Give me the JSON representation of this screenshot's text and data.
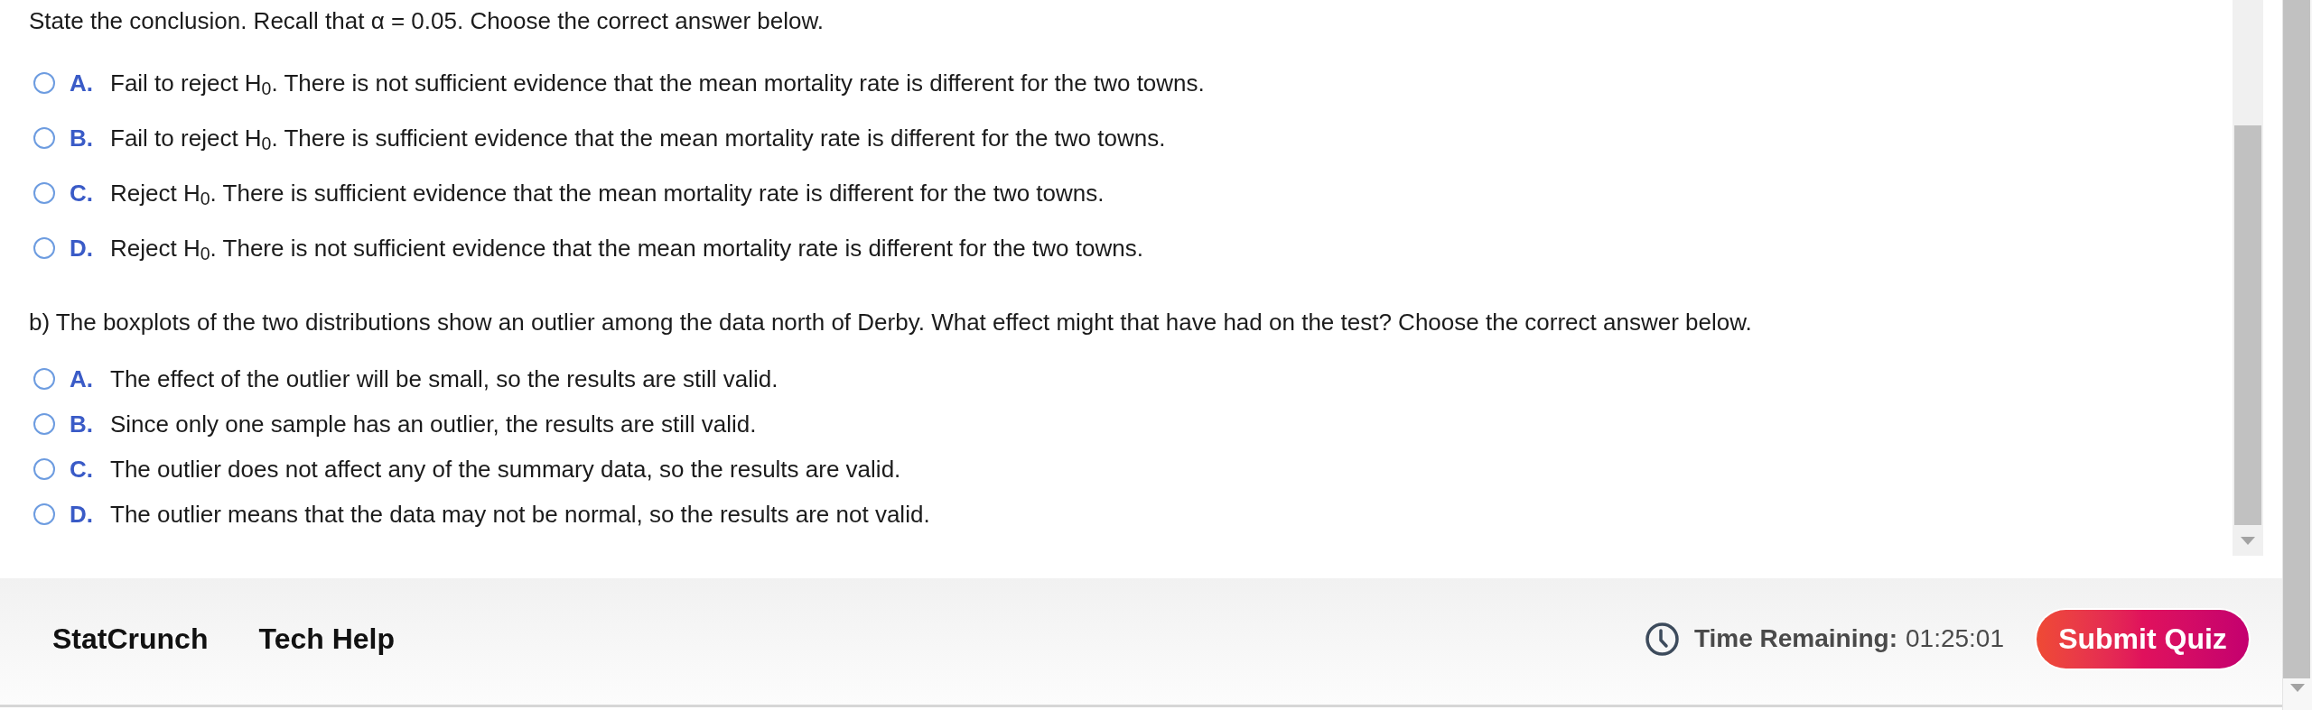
{
  "part_a": {
    "prompt": "State the conclusion. Recall that α = 0.05. Choose the correct answer below.",
    "options": [
      {
        "letter": "A.",
        "text": "Fail to reject H$_{0}$. There is not sufficient evidence that the mean mortality rate is different for the two towns.",
        "selected": false
      },
      {
        "letter": "B.",
        "text": "Fail to reject H$_{0}$. There is sufficient evidence that the mean mortality rate is different for the two towns.",
        "selected": false
      },
      {
        "letter": "C.",
        "text": "Reject H$_{0}$. There is sufficient evidence that the mean mortality rate is different for the two towns.",
        "selected": false
      },
      {
        "letter": "D.",
        "text": "Reject H$_{0}$. There is not sufficient evidence that the mean mortality rate is different for the two towns.",
        "selected": false
      }
    ]
  },
  "part_b": {
    "prompt": "b) The boxplots of the two distributions show an outlier among the data north of Derby. What effect might that have had on the test? Choose the correct answer below.",
    "options": [
      {
        "letter": "A.",
        "text": "The effect of the outlier will be small, so the results are still valid.",
        "selected": false
      },
      {
        "letter": "B.",
        "text": "Since only one sample has an outlier, the results are still valid.",
        "selected": false
      },
      {
        "letter": "C.",
        "text": "The outlier does not affect any of the summary data, so the results are valid.",
        "selected": false
      },
      {
        "letter": "D.",
        "text": "The outlier means that the data may not be normal, so the results are not valid.",
        "selected": false
      }
    ]
  },
  "footer": {
    "links": [
      "StatCrunch",
      "Tech Help"
    ],
    "timer": {
      "label": "Time Remaining:",
      "value": "01:25:01"
    },
    "submit_button": "Submit Quiz"
  }
}
